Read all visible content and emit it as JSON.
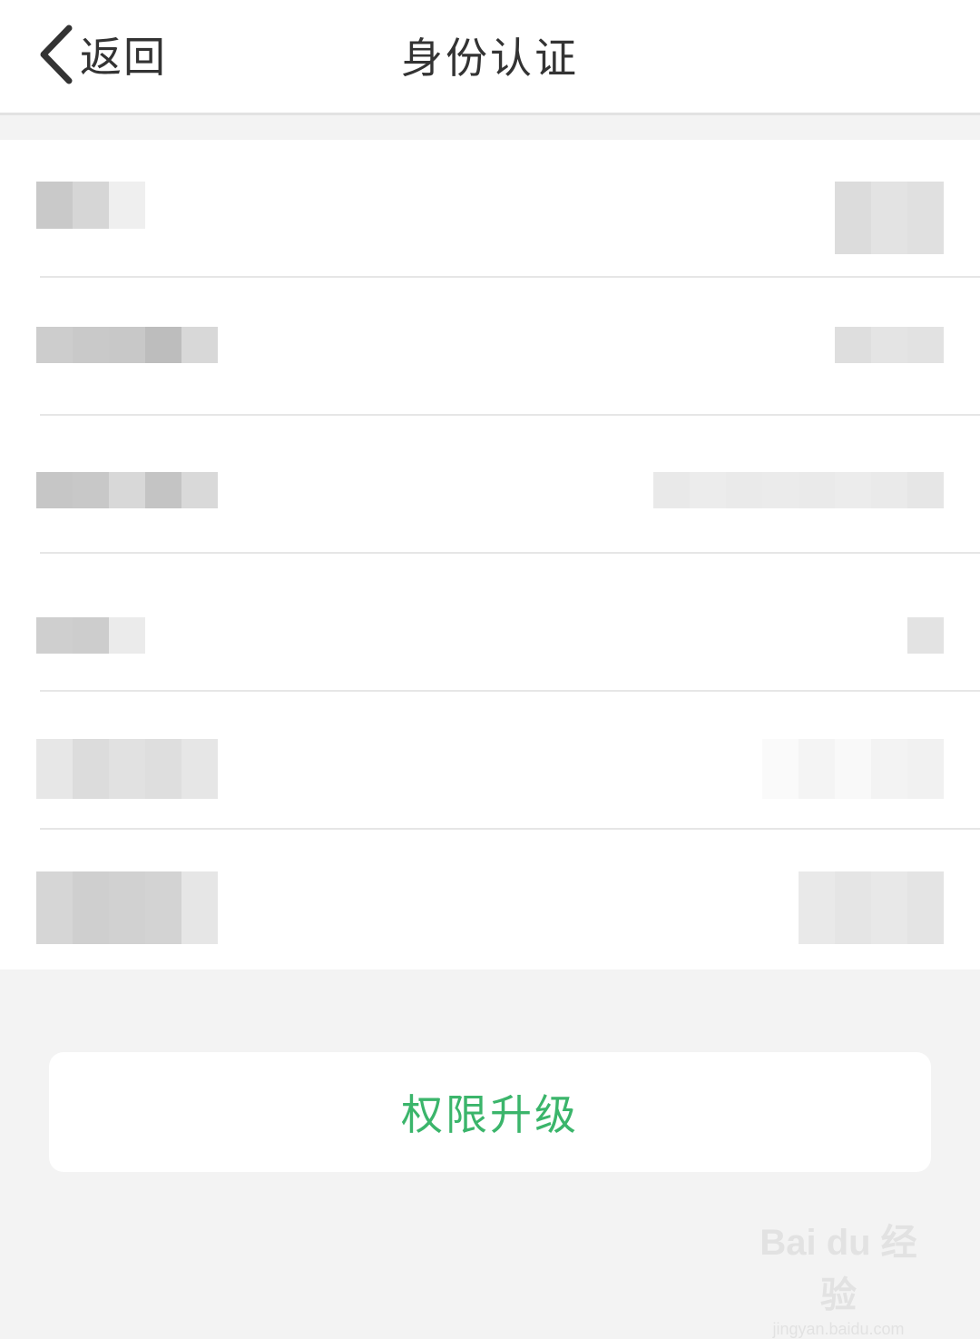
{
  "header": {
    "back_label": "返回",
    "title": "身份认证",
    "back_icon": "chevron-left-icon"
  },
  "list": {
    "rows": [
      {
        "state": "pixelated"
      },
      {
        "state": "pixelated"
      },
      {
        "state": "pixelated"
      },
      {
        "state": "pixelated"
      },
      {
        "state": "pixelated"
      },
      {
        "state": "pixelated"
      }
    ]
  },
  "action": {
    "upgrade_label": "权限升级",
    "accent_color": "#3bb56b"
  },
  "watermark": {
    "logo": "Bai du 经验",
    "url": "jingyan.baidu.com"
  }
}
